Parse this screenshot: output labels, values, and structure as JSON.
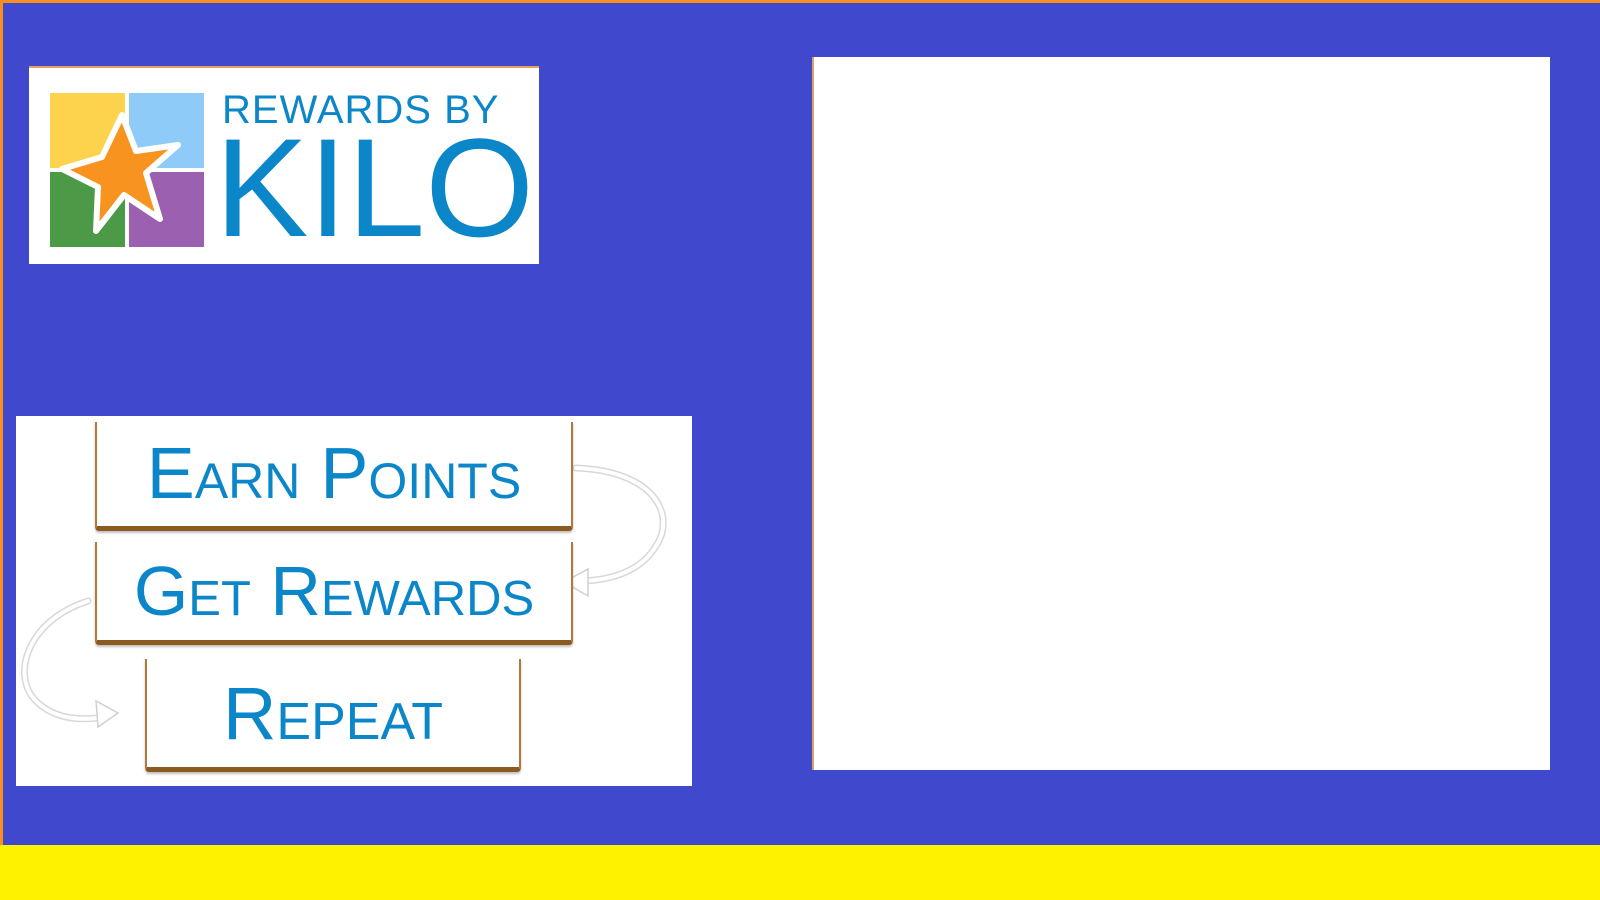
{
  "logo": {
    "line1": "REWARDS BY",
    "line2": "KILO",
    "icon": "star-tiles-icon",
    "colors": {
      "text": "#0a86c9",
      "tile_yellow": "#fdd24c",
      "tile_blue": "#8ecbf9",
      "tile_green": "#4c9a47",
      "tile_purple": "#9b61b0",
      "star": "#f7931e"
    }
  },
  "steps": [
    {
      "label": "Earn Points"
    },
    {
      "label": "Get Rewards"
    },
    {
      "label": "Repeat"
    }
  ],
  "colors": {
    "background": "#4049cd",
    "border": "#f7901e",
    "footer": "#fff200",
    "step_text": "#0a86c9",
    "step_shadow": "#8b5a1e"
  }
}
